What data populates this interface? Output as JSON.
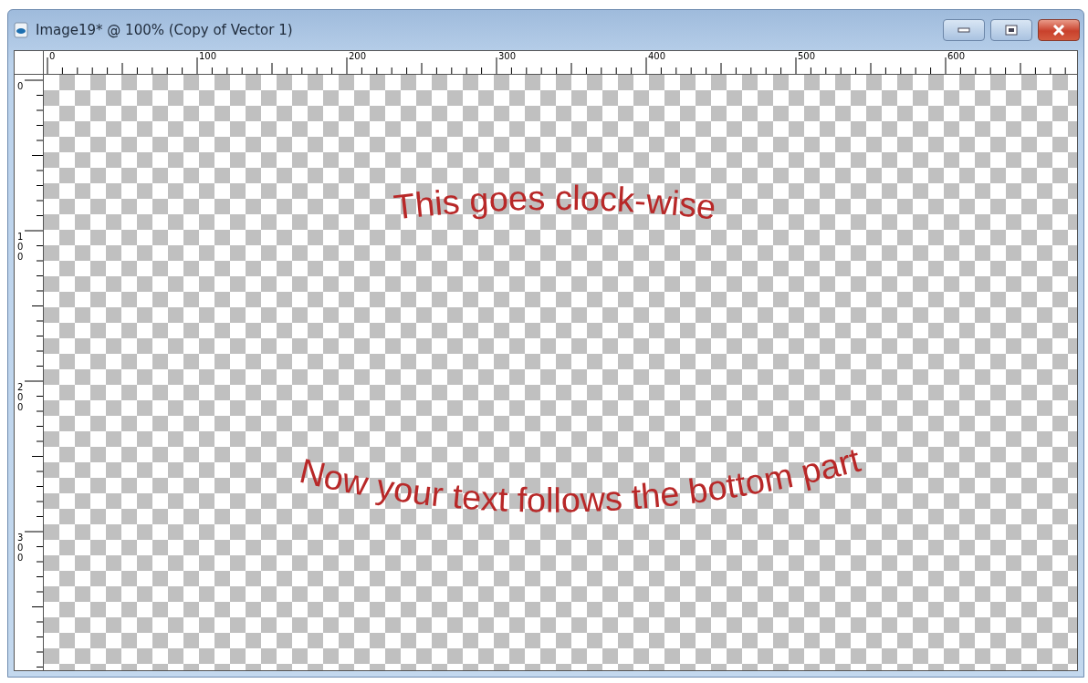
{
  "window": {
    "title": "Image19* @ 100% (Copy of Vector 1)"
  },
  "rulers": {
    "horizontal": [
      "0",
      "100",
      "200",
      "300",
      "400",
      "500",
      "600"
    ],
    "vertical": [
      "0",
      "100",
      "200",
      "300"
    ]
  },
  "canvas": {
    "texts": [
      {
        "text": "This goes clock-wise",
        "kind": "arc-up"
      },
      {
        "text": "Now your text follows the bottom part",
        "kind": "arc-down"
      }
    ]
  }
}
